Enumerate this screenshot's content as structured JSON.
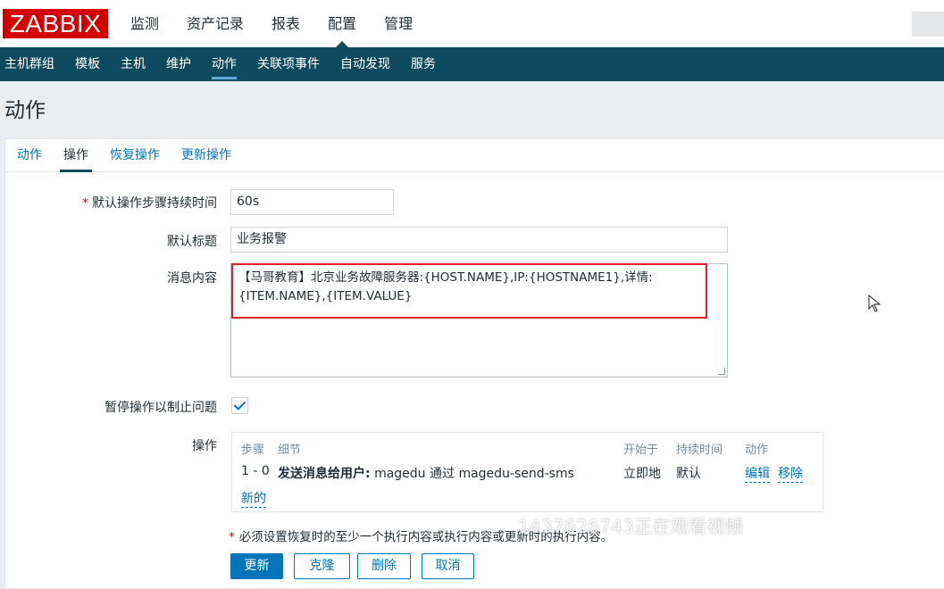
{
  "logo": "ZABBIX",
  "top_nav": [
    "监测",
    "资产记录",
    "报表",
    "配置",
    "管理"
  ],
  "sub_nav": [
    "主机群组",
    "模板",
    "主机",
    "维护",
    "动作",
    "关联项事件",
    "自动发现",
    "服务"
  ],
  "page_title": "动作",
  "tabs": [
    "动作",
    "操作",
    "恢复操作",
    "更新操作"
  ],
  "form": {
    "default_step_duration_label": "默认操作步骤持续时间",
    "default_step_duration_value": "60s",
    "default_subject_label": "默认标题",
    "default_subject_value": "业务报警",
    "message_label": "消息内容",
    "message_value": "【马哥教育】北京业务故障服务器:{HOST.NAME},IP:{HOSTNAME1},详情:{ITEM.NAME},{ITEM.VALUE}",
    "pause_label": "暂停操作以制止问题",
    "operations_label": "操作"
  },
  "operations_table": {
    "headers": [
      "步骤",
      "细节",
      "开始于",
      "持续时间",
      "动作"
    ],
    "row": {
      "step": "1 - 0",
      "detail_bold": "发送消息给用户:",
      "detail_rest": "magedu 通过 magedu-send-sms",
      "start": "立即地",
      "duration": "默认",
      "edit": "编辑",
      "remove": "移除"
    },
    "new_link": "新的"
  },
  "required_note": "必须设置恢复时的至少一个执行内容或执行内容或更新时的执行内容。",
  "watermark": "1437626743正在观看视频",
  "buttons": {
    "update": "更新",
    "clone": "克隆",
    "delete": "删除",
    "cancel": "取消"
  }
}
